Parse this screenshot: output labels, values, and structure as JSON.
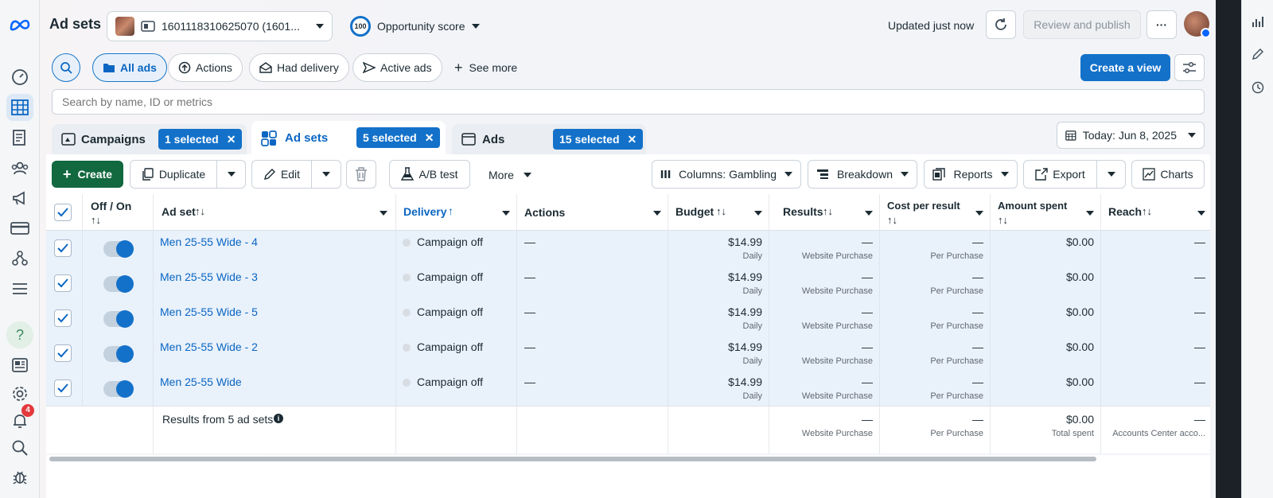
{
  "header": {
    "title": "Ad sets",
    "account": "1601118310625070 (1601...",
    "opportunity_score": "100",
    "opportunity_label": "Opportunity score",
    "updated": "Updated just now",
    "review_publish": "Review and publish",
    "more": "···"
  },
  "filters": {
    "all_ads": "All ads",
    "actions": "Actions",
    "had_delivery": "Had delivery",
    "active_ads": "Active ads",
    "see_more": "See more",
    "create_view": "Create a view",
    "search_placeholder": "Search by name, ID or metrics"
  },
  "tabs": {
    "campaigns": {
      "label": "Campaigns",
      "chip": "1 selected"
    },
    "adsets": {
      "label": "Ad sets",
      "chip": "5 selected"
    },
    "ads": {
      "label": "Ads",
      "chip": "15 selected"
    },
    "date": "Today: Jun 8, 2025"
  },
  "toolbar": {
    "create": "Create",
    "duplicate": "Duplicate",
    "edit": "Edit",
    "ab_test": "A/B test",
    "more": "More",
    "columns": "Columns: Gambling",
    "breakdown": "Breakdown",
    "reports": "Reports",
    "export": "Export",
    "charts": "Charts"
  },
  "table": {
    "headers": {
      "offon": "Off / On",
      "adset": "Ad set",
      "delivery": "Delivery",
      "actions": "Actions",
      "budget": "Budget",
      "results": "Results",
      "cpr": "Cost per result",
      "amount": "Amount spent",
      "reach": "Reach",
      "sort": "↑↓",
      "sort_up": "↑"
    },
    "rows": [
      {
        "name": "Men 25-55 Wide - 4",
        "delivery": "Campaign off",
        "actions": "—",
        "budget": "$14.99",
        "budget_sub": "Daily",
        "results": "—",
        "results_sub": "Website Purchase",
        "cpr": "—",
        "cpr_sub": "Per Purchase",
        "amount": "$0.00",
        "reach": "—"
      },
      {
        "name": "Men 25-55 Wide - 3",
        "delivery": "Campaign off",
        "actions": "—",
        "budget": "$14.99",
        "budget_sub": "Daily",
        "results": "—",
        "results_sub": "Website Purchase",
        "cpr": "—",
        "cpr_sub": "Per Purchase",
        "amount": "$0.00",
        "reach": "—"
      },
      {
        "name": "Men 25-55 Wide - 5",
        "delivery": "Campaign off",
        "actions": "—",
        "budget": "$14.99",
        "budget_sub": "Daily",
        "results": "—",
        "results_sub": "Website Purchase",
        "cpr": "—",
        "cpr_sub": "Per Purchase",
        "amount": "$0.00",
        "reach": "—"
      },
      {
        "name": "Men 25-55 Wide - 2",
        "delivery": "Campaign off",
        "actions": "—",
        "budget": "$14.99",
        "budget_sub": "Daily",
        "results": "—",
        "results_sub": "Website Purchase",
        "cpr": "—",
        "cpr_sub": "Per Purchase",
        "amount": "$0.00",
        "reach": "—"
      },
      {
        "name": "Men 25-55 Wide",
        "delivery": "Campaign off",
        "actions": "—",
        "budget": "$14.99",
        "budget_sub": "Daily",
        "results": "—",
        "results_sub": "Website Purchase",
        "cpr": "—",
        "cpr_sub": "Per Purchase",
        "amount": "$0.00",
        "reach": "—"
      }
    ],
    "footer": {
      "label": "Results from 5 ad sets",
      "results": "—",
      "results_sub": "Website Purchase",
      "cpr": "—",
      "cpr_sub": "Per Purchase",
      "amount": "$0.00",
      "amount_sub": "Total spent",
      "reach": "—",
      "reach_sub": "Accounts Center acco..."
    }
  },
  "nav": {
    "notifications": "4"
  },
  "colors": {
    "accent": "#1371c9",
    "create": "#12683f",
    "row_selected": "#e9f1fb"
  }
}
